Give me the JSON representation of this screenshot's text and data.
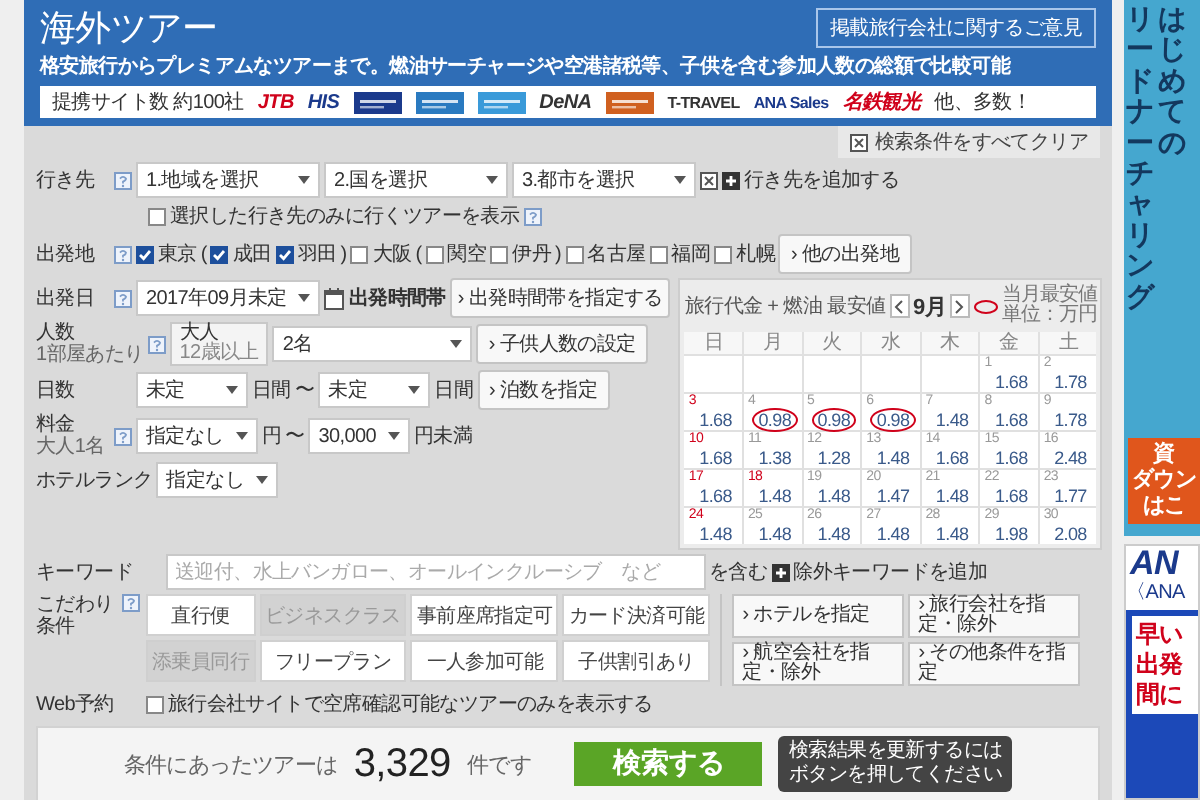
{
  "header": {
    "title": "海外ツアー",
    "feedback_button": "掲載旅行会社に関するご意見",
    "subtitle": "格安旅行からプレミアムなツアーまで。燃油サーチャージや空港諸税等、子供を含む参加人数の総額で比較可能",
    "partners": {
      "label": "提携サイト数 約100社",
      "more": "他、多数！",
      "logos": [
        {
          "kind": "wordmark",
          "label": "JTB",
          "color": "#d0021b"
        },
        {
          "kind": "wordmark",
          "label": "HIS",
          "color": "#1b3a8c"
        },
        {
          "kind": "emblem",
          "color": "#1b3a8c"
        },
        {
          "kind": "emblem",
          "color": "#2a7ac0"
        },
        {
          "kind": "emblem",
          "color": "#3a9ad9"
        },
        {
          "kind": "wordmark",
          "label": "DeNA",
          "color": "#333333"
        },
        {
          "kind": "emblem",
          "color": "#d06020"
        },
        {
          "kind": "wordmark",
          "label": "T-TRAVEL",
          "color": "#333333"
        },
        {
          "kind": "wordmark",
          "label": "ANA Sales",
          "color": "#1b3a8c"
        },
        {
          "kind": "wordmark",
          "label": "名鉄観光",
          "color": "#d0021b"
        }
      ]
    }
  },
  "clear_all": "検索条件をすべてクリア",
  "destination": {
    "label": "行き先",
    "selects": [
      "1.地域を選択",
      "2.国を選択",
      "3.都市を選択"
    ],
    "add_link": "行き先を追加する",
    "only_selected": {
      "label": "選択した行き先のみに行くツアーを表示",
      "checked": false
    }
  },
  "origin": {
    "label": "出発地",
    "more_button": "› 他の出発地",
    "items": [
      {
        "kind": "checkbox",
        "label": "東京",
        "checked": true
      },
      {
        "kind": "text",
        "text": "("
      },
      {
        "kind": "checkbox",
        "label": "成田",
        "checked": true
      },
      {
        "kind": "checkbox",
        "label": "羽田",
        "checked": true
      },
      {
        "kind": "text",
        "text": ")"
      },
      {
        "kind": "checkbox",
        "label": "大阪",
        "checked": false
      },
      {
        "kind": "text",
        "text": "("
      },
      {
        "kind": "checkbox",
        "label": "関空",
        "checked": false
      },
      {
        "kind": "checkbox",
        "label": "伊丹",
        "checked": false
      },
      {
        "kind": "text",
        "text": ")"
      },
      {
        "kind": "checkbox",
        "label": "名古屋",
        "checked": false
      },
      {
        "kind": "checkbox",
        "label": "福岡",
        "checked": false
      },
      {
        "kind": "checkbox",
        "label": "札幌",
        "checked": false
      }
    ]
  },
  "departure": {
    "label": "出発日",
    "select": "2017年09月未定",
    "time_label": "出発時間帯",
    "time_button": "› 出発時間帯を指定する"
  },
  "travelers": {
    "label": "人数",
    "sublabel": "1部屋あたり",
    "adult_label": "大人",
    "adult_note": "12歳以上",
    "select": "2名",
    "child_button": "› 子供人数の設定"
  },
  "days": {
    "label": "日数",
    "from": "未定",
    "unit_from": "日間",
    "tilde": "〜",
    "to": "未定",
    "unit_to": "日間",
    "nights_button": "› 泊数を指定"
  },
  "price": {
    "label": "料金",
    "sublabel": "大人1名",
    "from": "指定なし",
    "unit_from": "円",
    "tilde": "〜",
    "to": "30,000",
    "unit_to": "円未満"
  },
  "hotel_rank": {
    "label": "ホテルランク",
    "select": "指定なし"
  },
  "keyword": {
    "label": "キーワード",
    "placeholder": "送迎付、水上バンガロー、オールインクルーシブ　など",
    "suffix": "を含む",
    "exclude_link": "除外キーワードを追加"
  },
  "preferences": {
    "label": "こだわり条件",
    "toggles": [
      {
        "label": "直行便",
        "disabled": false
      },
      {
        "label": "ビジネスクラス",
        "disabled": true
      },
      {
        "label": "事前座席指定可",
        "disabled": false
      },
      {
        "label": "カード決済可能",
        "disabled": false
      },
      {
        "label": "添乗員同行",
        "disabled": true
      },
      {
        "label": "フリープラン",
        "disabled": false
      },
      {
        "label": "一人参加可能",
        "disabled": false
      },
      {
        "label": "子供割引あり",
        "disabled": false
      }
    ],
    "buttons": [
      "› ホテルを指定",
      "› 旅行会社を指定・除外",
      "› 航空会社を指定・除外",
      "› その他条件を指定"
    ]
  },
  "web_booking": {
    "label": "Web予約",
    "option": {
      "label": "旅行会社サイトで空席確認可能なツアーのみを表示する",
      "checked": false
    }
  },
  "calendar": {
    "title": "旅行代金 + 燃油 最安値",
    "month": "9月",
    "legend": "当月最安値",
    "unit": "単位：万円",
    "weekdays": [
      "日",
      "月",
      "火",
      "水",
      "木",
      "金",
      "土"
    ],
    "weeks": [
      [
        {
          "kind": "empty"
        },
        {
          "kind": "empty"
        },
        {
          "kind": "empty"
        },
        {
          "kind": "empty"
        },
        {
          "kind": "empty"
        },
        {
          "kind": "day",
          "day": "1",
          "price": "1.68",
          "holiday": false,
          "lowest": false
        },
        {
          "kind": "day",
          "day": "2",
          "price": "1.78",
          "holiday": false,
          "lowest": false
        }
      ],
      [
        {
          "kind": "day",
          "day": "3",
          "price": "1.68",
          "holiday": true,
          "lowest": false
        },
        {
          "kind": "day",
          "day": "4",
          "price": "0.98",
          "holiday": false,
          "lowest": true
        },
        {
          "kind": "day",
          "day": "5",
          "price": "0.98",
          "holiday": false,
          "lowest": true
        },
        {
          "kind": "day",
          "day": "6",
          "price": "0.98",
          "holiday": false,
          "lowest": true
        },
        {
          "kind": "day",
          "day": "7",
          "price": "1.48",
          "holiday": false,
          "lowest": false
        },
        {
          "kind": "day",
          "day": "8",
          "price": "1.68",
          "holiday": false,
          "lowest": false
        },
        {
          "kind": "day",
          "day": "9",
          "price": "1.78",
          "holiday": false,
          "lowest": false
        }
      ],
      [
        {
          "kind": "day",
          "day": "10",
          "price": "1.68",
          "holiday": true,
          "lowest": false
        },
        {
          "kind": "day",
          "day": "11",
          "price": "1.38",
          "holiday": false,
          "lowest": false
        },
        {
          "kind": "day",
          "day": "12",
          "price": "1.28",
          "holiday": false,
          "lowest": false
        },
        {
          "kind": "day",
          "day": "13",
          "price": "1.48",
          "holiday": false,
          "lowest": false
        },
        {
          "kind": "day",
          "day": "14",
          "price": "1.68",
          "holiday": false,
          "lowest": false
        },
        {
          "kind": "day",
          "day": "15",
          "price": "1.68",
          "holiday": false,
          "lowest": false
        },
        {
          "kind": "day",
          "day": "16",
          "price": "2.48",
          "holiday": false,
          "lowest": false
        }
      ],
      [
        {
          "kind": "day",
          "day": "17",
          "price": "1.68",
          "holiday": true,
          "lowest": false
        },
        {
          "kind": "day",
          "day": "18",
          "price": "1.48",
          "holiday": true,
          "lowest": false
        },
        {
          "kind": "day",
          "day": "19",
          "price": "1.48",
          "holiday": false,
          "lowest": false
        },
        {
          "kind": "day",
          "day": "20",
          "price": "1.47",
          "holiday": false,
          "lowest": false
        },
        {
          "kind": "day",
          "day": "21",
          "price": "1.48",
          "holiday": false,
          "lowest": false
        },
        {
          "kind": "day",
          "day": "22",
          "price": "1.68",
          "holiday": false,
          "lowest": false
        },
        {
          "kind": "day",
          "day": "23",
          "price": "1.77",
          "holiday": false,
          "lowest": false
        }
      ],
      [
        {
          "kind": "day",
          "day": "24",
          "price": "1.48",
          "holiday": true,
          "lowest": false
        },
        {
          "kind": "day",
          "day": "25",
          "price": "1.48",
          "holiday": false,
          "lowest": false
        },
        {
          "kind": "day",
          "day": "26",
          "price": "1.48",
          "holiday": false,
          "lowest": false
        },
        {
          "kind": "day",
          "day": "27",
          "price": "1.48",
          "holiday": false,
          "lowest": false
        },
        {
          "kind": "day",
          "day": "28",
          "price": "1.48",
          "holiday": false,
          "lowest": false
        },
        {
          "kind": "day",
          "day": "29",
          "price": "1.98",
          "holiday": false,
          "lowest": false
        },
        {
          "kind": "day",
          "day": "30",
          "price": "2.08",
          "holiday": false,
          "lowest": false
        }
      ]
    ]
  },
  "results": {
    "prefix": "条件にあったツアーは",
    "count": "3,329",
    "suffix": "件です",
    "search_button": "検索する",
    "tooltip_lines": [
      "検索結果を更新するには",
      "ボタンを押してください"
    ]
  },
  "ads": [
    {
      "kind": "vertical",
      "columns": [
        "リードナーチャリング",
        "はじめての"
      ],
      "button_lines": [
        "資",
        "ダウン",
        "はこ"
      ]
    },
    {
      "kind": "airline",
      "logo": "AN",
      "note": "〈ANA",
      "lines": [
        "早い",
        "出発",
        "間に"
      ]
    }
  ]
}
